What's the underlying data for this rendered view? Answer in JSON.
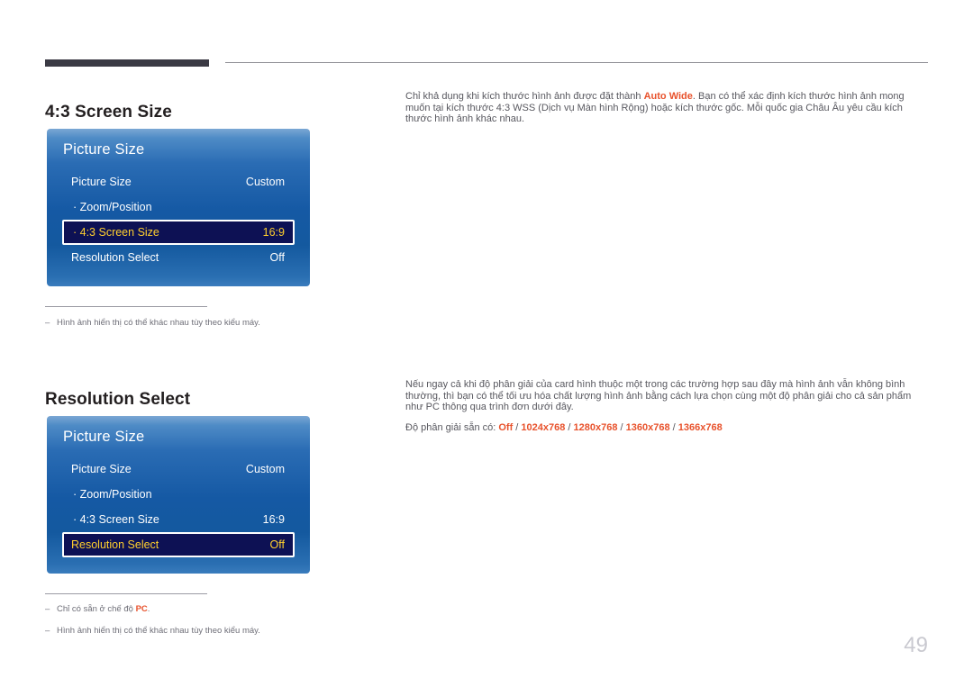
{
  "page": {
    "number": "49"
  },
  "sections": [
    {
      "heading": "4:3 Screen Size",
      "osd": {
        "title": "Picture Size",
        "rows": [
          {
            "label": "Picture Size",
            "value": "Custom"
          },
          {
            "label": "· Zoom/Position",
            "value": ""
          },
          {
            "label": "· 4:3 Screen Size",
            "value": "16:9"
          },
          {
            "label": "Resolution Select",
            "value": "Off"
          }
        ],
        "selected_index": 2
      },
      "paragraph": {
        "before": "Chỉ khả dụng khi kích thước hình ảnh được đặt thành ",
        "accent": "Auto Wide",
        "after": ". Bạn có thể xác định kích thước hình ảnh mong muốn tại kích thước 4:3 WSS (Dịch vụ Màn hình Rộng) hoặc kích thước gốc. Mỗi quốc gia Châu Âu yêu cầu kích thước hình ảnh khác nhau."
      },
      "notes": [
        {
          "dash": "–",
          "text": "Hình ảnh hiển thị có thể khác nhau tùy theo kiểu máy."
        }
      ]
    },
    {
      "heading": "Resolution Select",
      "osd": {
        "title": "Picture Size",
        "rows": [
          {
            "label": "Picture Size",
            "value": "Custom"
          },
          {
            "label": "· Zoom/Position",
            "value": ""
          },
          {
            "label": "· 4:3 Screen Size",
            "value": "16:9"
          },
          {
            "label": "Resolution Select",
            "value": "Off"
          }
        ],
        "selected_index": 3
      },
      "paragraph": {
        "text": "Nếu ngay cả khi độ phân giải của card hình thuộc một trong các trường hợp sau đây mà hình ảnh vẫn không bình thường, thì bạn có thể tối ưu hóa chất lượng hình ảnh bằng cách lựa chọn cùng một độ phân giải cho cả sản phẩm như PC thông qua trình đơn dưới đây."
      },
      "resolution_line": {
        "label": "Độ phân giải sẵn có: ",
        "options": [
          "Off",
          "1024x768",
          "1280x768",
          "1360x768",
          "1366x768"
        ],
        "separator": " / "
      },
      "notes": [
        {
          "dash": "–",
          "before": "Chỉ có sẵn ở chế độ ",
          "highlight": "PC",
          "after": "."
        },
        {
          "dash": "–",
          "text": "Hình ảnh hiển thị có thể khác nhau tùy theo kiểu máy."
        }
      ]
    }
  ],
  "colors": {
    "accent": "#e8522c",
    "osd_selected_text": "#ffcf2e",
    "osd_selected_bg": "#0d1154",
    "header_bar": "#3b3a44",
    "body_text": "#58585f"
  }
}
